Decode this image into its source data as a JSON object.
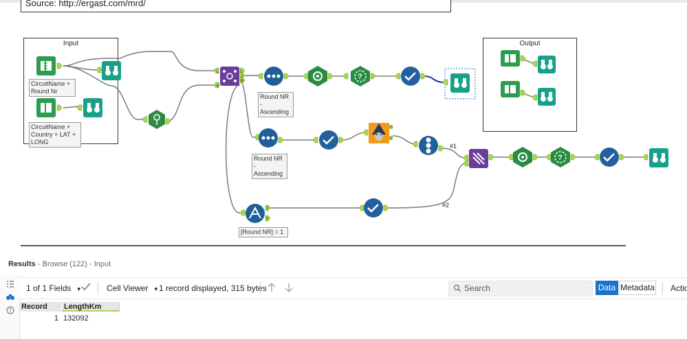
{
  "canvas": {
    "comment_text": "Source: http://ergast.com/mrd/",
    "containers": {
      "input_title": "Input",
      "output_title": "Output"
    },
    "labels": {
      "circuit_round": [
        "CircuitName +",
        "Round Nr"
      ],
      "circuit_country": [
        "CircuitName +",
        "Country + LAT +",
        "LONG"
      ],
      "sort1": [
        "Round NR -",
        "Ascending"
      ],
      "sort2": [
        "Round NR -",
        "Ascending"
      ],
      "filter": [
        "[Round NR] = 1"
      ]
    },
    "connection_labels": {
      "c1": "#1",
      "c2": "#2"
    },
    "anchor_letters": {
      "j_left_l": "L",
      "j_left_r": "R",
      "j_out_l": "L",
      "j_out_j": "J",
      "j_out_r": "R",
      "filter_t": "T",
      "filter_f": "F",
      "mc_o": "O",
      "mc_u": "U"
    },
    "colors": {
      "input_green": "#2e9c4e",
      "browse_teal": "#17a08a",
      "join_purple": "#6a3d9a",
      "sort_blue": "#1f5f98",
      "formula_blue": "#2068a8",
      "select_blue": "#23609e",
      "spatial_green": "#2f8b43",
      "transform_green": "#2a8b42",
      "macro_orange": "#f39a1d",
      "anchor_green": "#a8d84e",
      "selected_blue": "#1a6fc4"
    }
  },
  "results": {
    "title": "Results",
    "subtitle": "- Browse (122) - Input"
  },
  "toolbar": {
    "fields": "1 of 1 Fields",
    "cell_viewer": "Cell Viewer",
    "record_info": "1 record displayed, 315 bytes",
    "search_placeholder": "Search",
    "data_tab": "Data",
    "metadata_tab": "Metadata",
    "actions": "Actio"
  },
  "table": {
    "headers": [
      "Record",
      "LengthKm"
    ],
    "rows": [
      [
        "1",
        "132092"
      ]
    ]
  },
  "icons": [
    "list-icon",
    "binoculars-icon",
    "help-icon",
    "checkmark-icon",
    "arrow-up-icon",
    "arrow-down-icon",
    "search-icon"
  ]
}
